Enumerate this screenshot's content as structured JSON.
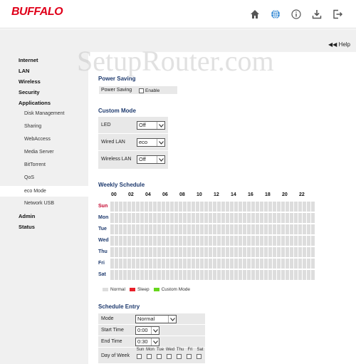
{
  "brand": "BUFFALO",
  "top_icons": [
    "home-icon",
    "globe-icon",
    "info-icon",
    "download-icon",
    "logout-icon"
  ],
  "help": "Help",
  "watermark": "SetupRouter.com",
  "sidebar": {
    "items": [
      {
        "label": "Internet",
        "level": 0
      },
      {
        "label": "LAN",
        "level": 0
      },
      {
        "label": "Wireless",
        "level": 0
      },
      {
        "label": "Security",
        "level": 0
      },
      {
        "label": "Applications",
        "level": 0
      },
      {
        "label": "Disk Management",
        "level": 1
      },
      {
        "label": "Sharing",
        "level": 1
      },
      {
        "label": "WebAccess",
        "level": 1
      },
      {
        "label": "Media Server",
        "level": 1
      },
      {
        "label": "BitTorrent",
        "level": 1
      },
      {
        "label": "QoS",
        "level": 1
      },
      {
        "label": "eco Mode",
        "level": 1,
        "active": true
      },
      {
        "label": "Network USB",
        "level": 1
      },
      {
        "label": "Admin",
        "level": 0
      },
      {
        "label": "Status",
        "level": 0
      }
    ]
  },
  "power_saving": {
    "title": "Power Saving",
    "label": "Power Saving",
    "enable": "Enable"
  },
  "custom_mode": {
    "title": "Custom Mode",
    "rows": [
      {
        "label": "LED",
        "value": "Off"
      },
      {
        "label": "Wired LAN",
        "value": "eco"
      },
      {
        "label": "Wireless LAN",
        "value": "Off"
      }
    ]
  },
  "weekly_schedule": {
    "title": "Weekly Schedule",
    "hours": [
      "00",
      "02",
      "04",
      "06",
      "08",
      "10",
      "12",
      "14",
      "16",
      "18",
      "20",
      "22"
    ],
    "days": [
      {
        "label": "Sun",
        "color": "#c4002a"
      },
      {
        "label": "Mon",
        "color": "#1e3a6e"
      },
      {
        "label": "Tue",
        "color": "#1e3a6e"
      },
      {
        "label": "Wed",
        "color": "#1e3a6e"
      },
      {
        "label": "Thu",
        "color": "#1e3a6e"
      },
      {
        "label": "Fri",
        "color": "#1e3a6e"
      },
      {
        "label": "Sat",
        "color": "#1e3a6e"
      }
    ],
    "legend": [
      {
        "label": "Normal",
        "color": "#dddddd"
      },
      {
        "label": "Sleep",
        "color": "#e8202a"
      },
      {
        "label": "Custom Mode",
        "color": "#66d61c"
      }
    ]
  },
  "schedule_entry": {
    "title": "Schedule Entry",
    "mode_label": "Mode",
    "mode_value": "Normal",
    "start_label": "Start Time",
    "start_value": "0:00",
    "end_label": "End Time",
    "end_value": "0:30",
    "dow_label": "Day of Week",
    "dow": [
      "Sun",
      "Mon",
      "Tue",
      "Wed",
      "Thu",
      "Fri",
      "Sat"
    ]
  }
}
